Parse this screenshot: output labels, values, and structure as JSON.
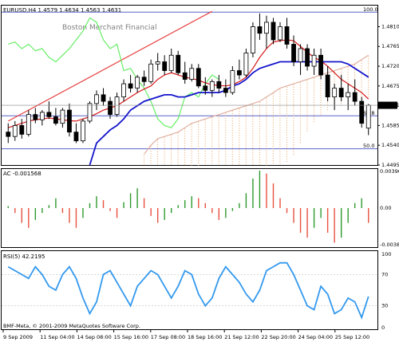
{
  "chart_data": [
    {
      "type": "candlestick",
      "title": "EURUSD,H4  1.4579 1.4634 1.4563 1.4631",
      "watermark": "Boston Merchant Financial",
      "ylim": [
        1.4495,
        1.4858
      ],
      "yticks": [
        "1.4810",
        "1.4765",
        "1.4720",
        "1.4675",
        "1.4631",
        "1.4585",
        "1.4540",
        "1.4495"
      ],
      "current_price": "1.4631",
      "fib_labels": [
        {
          "text": "100.0",
          "y": 1.4843
        },
        {
          "text": "61.8",
          "y": 1.4607
        },
        {
          "text": "50.0",
          "y": 1.4532
        }
      ],
      "candles": [
        [
          1.457,
          1.459,
          1.4545,
          1.456
        ],
        [
          1.456,
          1.4595,
          1.455,
          1.4585
        ],
        [
          1.4585,
          1.46,
          1.4555,
          1.4565
        ],
        [
          1.4565,
          1.462,
          1.456,
          1.461
        ],
        [
          1.461,
          1.4625,
          1.459,
          1.4598
        ],
        [
          1.4598,
          1.462,
          1.4585,
          1.4615
        ],
        [
          1.4615,
          1.464,
          1.46,
          1.4605
        ],
        [
          1.4605,
          1.4625,
          1.4585,
          1.459
        ],
        [
          1.459,
          1.4625,
          1.458,
          1.462
        ],
        [
          1.462,
          1.4635,
          1.456,
          1.457
        ],
        [
          1.457,
          1.459,
          1.4545,
          1.455
        ],
        [
          1.455,
          1.46,
          1.4545,
          1.4595
        ],
        [
          1.4595,
          1.464,
          1.459,
          1.4635
        ],
        [
          1.4635,
          1.4665,
          1.462,
          1.4655
        ],
        [
          1.4655,
          1.467,
          1.463,
          1.464
        ],
        [
          1.464,
          1.465,
          1.46,
          1.461
        ],
        [
          1.461,
          1.466,
          1.4605,
          1.465
        ],
        [
          1.465,
          1.469,
          1.464,
          1.468
        ],
        [
          1.468,
          1.47,
          1.466,
          1.467
        ],
        [
          1.467,
          1.47,
          1.466,
          1.4695
        ],
        [
          1.4695,
          1.471,
          1.4675,
          1.4685
        ],
        [
          1.4685,
          1.4735,
          1.468,
          1.4725
        ],
        [
          1.4725,
          1.475,
          1.471,
          1.473
        ],
        [
          1.473,
          1.4745,
          1.47,
          1.471
        ],
        [
          1.471,
          1.476,
          1.4705,
          1.4745
        ],
        [
          1.4745,
          1.4755,
          1.47,
          1.4705
        ],
        [
          1.4705,
          1.473,
          1.468,
          1.469
        ],
        [
          1.469,
          1.4725,
          1.4685,
          1.4715
        ],
        [
          1.4715,
          1.4725,
          1.467,
          1.4675
        ],
        [
          1.4675,
          1.4695,
          1.4655,
          1.4665
        ],
        [
          1.4665,
          1.469,
          1.465,
          1.4685
        ],
        [
          1.4685,
          1.47,
          1.466,
          1.467
        ],
        [
          1.467,
          1.469,
          1.465,
          1.466
        ],
        [
          1.466,
          1.472,
          1.4655,
          1.471
        ],
        [
          1.471,
          1.4735,
          1.469,
          1.47
        ],
        [
          1.47,
          1.476,
          1.4695,
          1.475
        ],
        [
          1.475,
          1.482,
          1.474,
          1.481
        ],
        [
          1.481,
          1.484,
          1.478,
          1.4795
        ],
        [
          1.4795,
          1.4835,
          1.476,
          1.482
        ],
        [
          1.482,
          1.483,
          1.477,
          1.478
        ],
        [
          1.478,
          1.482,
          1.4775,
          1.481
        ],
        [
          1.481,
          1.483,
          1.476,
          1.477
        ],
        [
          1.477,
          1.479,
          1.472,
          1.473
        ],
        [
          1.473,
          1.477,
          1.47,
          1.476
        ],
        [
          1.476,
          1.477,
          1.471,
          1.472
        ],
        [
          1.472,
          1.476,
          1.47,
          1.4745
        ],
        [
          1.4745,
          1.476,
          1.469,
          1.47
        ],
        [
          1.47,
          1.472,
          1.464,
          1.465
        ],
        [
          1.465,
          1.468,
          1.462,
          1.467
        ],
        [
          1.467,
          1.47,
          1.464,
          1.465
        ],
        [
          1.465,
          1.468,
          1.462,
          1.466
        ],
        [
          1.466,
          1.469,
          1.463,
          1.464
        ],
        [
          1.464,
          1.465,
          1.458,
          1.459
        ],
        [
          1.4579,
          1.4634,
          1.4563,
          1.4631
        ]
      ],
      "ma_red": [
        1.458,
        1.4585,
        1.459,
        1.4595,
        1.4598,
        1.46,
        1.4602,
        1.46,
        1.4598,
        1.4596,
        1.4595,
        1.46,
        1.4605,
        1.4612,
        1.462,
        1.4625,
        1.463,
        1.464,
        1.465,
        1.466,
        1.4668,
        1.4675,
        1.469,
        1.47,
        1.4705,
        1.47,
        1.4695,
        1.4692,
        1.4688,
        1.4682,
        1.4678,
        1.4676,
        1.4675,
        1.4678,
        1.4685,
        1.4695,
        1.4715,
        1.474,
        1.476,
        1.4775,
        1.4778,
        1.478,
        1.4778,
        1.4765,
        1.4752,
        1.474,
        1.4732,
        1.472,
        1.4705,
        1.469,
        1.468,
        1.467,
        1.466,
        1.4645
      ],
      "ma_blue": [
        null,
        null,
        null,
        null,
        null,
        null,
        null,
        null,
        null,
        null,
        null,
        null,
        1.4495,
        1.4545,
        1.456,
        1.4575,
        1.4585,
        1.46,
        1.462,
        1.463,
        1.464,
        1.4645,
        1.465,
        1.4655,
        1.4655,
        1.465,
        1.465,
        1.4655,
        1.466,
        1.466,
        1.466,
        1.466,
        1.4665,
        1.4675,
        1.468,
        1.469,
        1.4705,
        1.4715,
        1.472,
        1.4725,
        1.473,
        1.473,
        1.473,
        1.473,
        1.473,
        1.473,
        1.473,
        1.473,
        1.473,
        1.473,
        1.4725,
        1.4715,
        1.4705,
        1.4695
      ],
      "chikou_green": [
        1.477,
        1.4775,
        1.476,
        1.477,
        1.4755,
        1.476,
        1.474,
        1.473,
        1.4745,
        1.476,
        1.478,
        1.48,
        1.483,
        1.482,
        1.478,
        1.476,
        1.477,
        1.471,
        1.4715,
        1.469,
        1.467,
        1.464,
        1.46,
        1.4585,
        1.458,
        1.46,
        1.465,
        1.466,
        1.465,
        1.468,
        1.47,
        1.469,
        null,
        null,
        null,
        null,
        null,
        null,
        null,
        null,
        null,
        null,
        null,
        null,
        null,
        null,
        null,
        null,
        null,
        null,
        null,
        null,
        null,
        null
      ],
      "trendline": [
        [
          1.4595,
          0
        ],
        [
          1.4845,
          30
        ]
      ],
      "cloud_upper": [
        null,
        null,
        null,
        null,
        null,
        null,
        null,
        null,
        null,
        null,
        null,
        null,
        null,
        null,
        null,
        null,
        null,
        null,
        null,
        null,
        1.452,
        1.454,
        1.4555,
        1.456,
        1.4565,
        1.457,
        1.458,
        1.459,
        1.4595,
        1.46,
        1.4605,
        1.461,
        1.4615,
        1.462,
        1.4625,
        1.463,
        1.4635,
        1.464,
        1.465,
        1.466,
        1.467,
        1.4675,
        1.468,
        1.4685,
        1.469,
        1.4695,
        1.47,
        1.4705,
        1.471,
        1.4715,
        1.472,
        1.4725,
        1.4735,
        1.4745
      ],
      "cloud_lower": [
        null,
        null,
        null,
        null,
        null,
        null,
        null,
        null,
        null,
        null,
        null,
        null,
        null,
        null,
        null,
        null,
        null,
        null,
        null,
        null,
        1.4495,
        1.4495,
        1.4495,
        1.4495,
        1.4495,
        1.4495,
        1.4495,
        1.4495,
        1.4495,
        1.4495,
        1.4495,
        1.4495,
        1.4495,
        1.4495,
        1.4495,
        1.4495,
        1.4495,
        1.4495,
        1.4495,
        1.4495,
        1.4495,
        1.45,
        1.452,
        1.4545,
        1.457,
        1.4595,
        1.461,
        1.462,
        1.4625,
        1.463,
        1.4635,
        1.464,
        1.4645,
        1.465
      ]
    },
    {
      "type": "bar",
      "title": "AC -0.001568",
      "ylim": [
        -0.00396,
        0.00396
      ],
      "yticks": [
        "0.003961",
        "0.00",
        "-0.00388"
      ],
      "values": [
        0.0002,
        -0.0005,
        -0.0015,
        -0.002,
        -0.0012,
        -0.0005,
        0.0003,
        0.001,
        -0.0005,
        -0.0015,
        -0.002,
        -0.001,
        0.0005,
        0.0012,
        0.0008,
        -0.0003,
        -0.001,
        0.0006,
        0.0015,
        0.002,
        0.001,
        -0.0008,
        -0.0015,
        -0.0012,
        -0.0005,
        0.0003,
        0.0008,
        0.0012,
        0.001,
        0.0005,
        -0.0005,
        -0.0012,
        -0.001,
        -0.0003,
        0.0005,
        0.0015,
        0.003,
        0.0038,
        0.0035,
        0.0025,
        0.001,
        -0.0005,
        -0.0015,
        -0.0025,
        -0.003,
        -0.002,
        -0.001,
        -0.0025,
        -0.0035,
        -0.003,
        -0.0015,
        0.0005,
        0.001,
        -0.0015
      ]
    },
    {
      "type": "line",
      "title": "RSI(5) 42.2195",
      "ylim": [
        0,
        100
      ],
      "yticks": [
        "100",
        "70",
        "30",
        "0"
      ],
      "values": [
        80,
        75,
        70,
        65,
        80,
        70,
        55,
        50,
        70,
        80,
        65,
        40,
        20,
        35,
        70,
        75,
        60,
        45,
        30,
        55,
        65,
        75,
        70,
        55,
        40,
        55,
        75,
        70,
        45,
        30,
        40,
        65,
        80,
        70,
        60,
        45,
        35,
        50,
        75,
        80,
        85,
        85,
        70,
        50,
        30,
        25,
        55,
        45,
        20,
        25,
        40,
        35,
        15,
        42
      ],
      "xticks": [
        "9 Sep 2009",
        "11 Sep 04:00",
        "14 Sep 08:00",
        "15 Sep 16:00",
        "17 Sep 08:00",
        "18 Sep 16:00",
        "21 Sep 12:00",
        "22 Sep 20:00",
        "24 Sep 04:00",
        "25 Sep 12:00"
      ]
    }
  ],
  "footer": "BMF-Meta, © 2001-2009 MetaQuotes Software Corp.",
  "colors": {
    "bull": "#2e9a2e",
    "bear": "#e85040",
    "ma_red": "#d61a1a",
    "ma_blue": "#1414cc",
    "chikou": "#66ee66",
    "trend": "#e84040",
    "cloud": "#e8a060",
    "rsi": "#3399ee",
    "grid": "#5a64c8"
  }
}
